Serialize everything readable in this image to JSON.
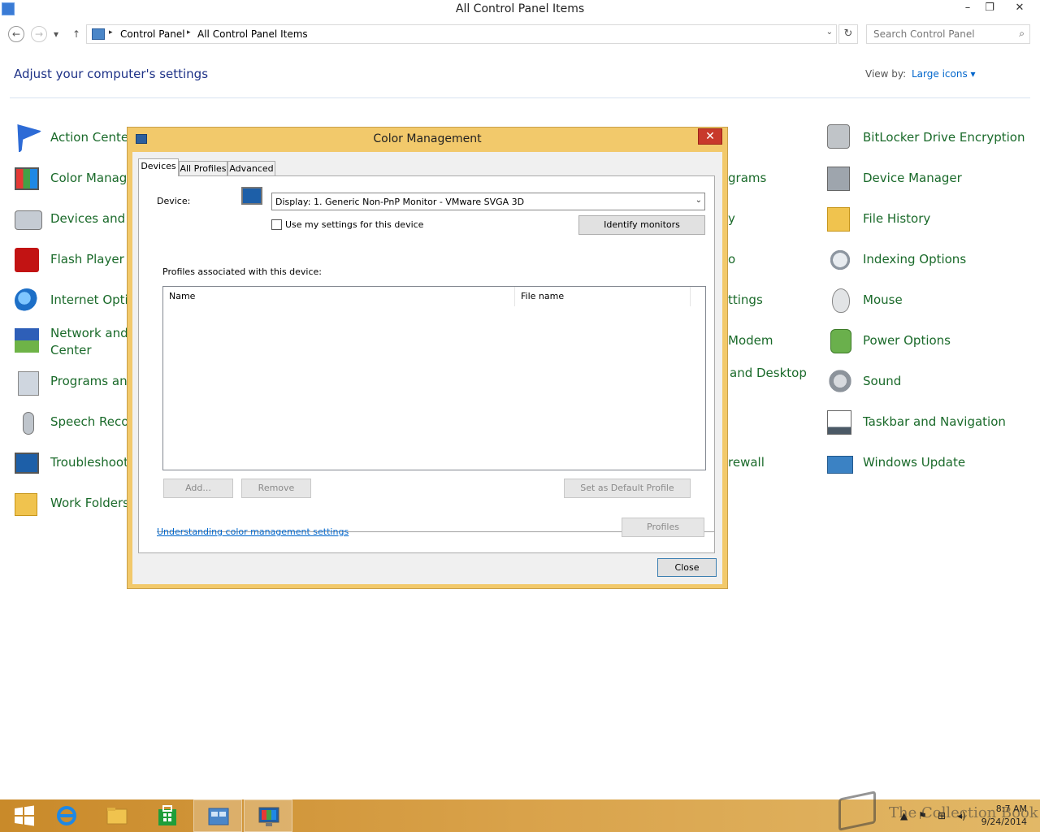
{
  "window": {
    "title": "All Control Panel Items",
    "minimize": "–",
    "restore": "❐",
    "close": "✕"
  },
  "nav": {
    "back": "←",
    "forward": "→",
    "recent": "▾",
    "up": "↑"
  },
  "address": {
    "crumbs": [
      "Control Panel",
      "All Control Panel Items"
    ],
    "separator": "▸",
    "dropdown": "⌄",
    "refresh": "↻"
  },
  "search": {
    "placeholder": "Search Control Panel",
    "icon": "⌕"
  },
  "heading": "Adjust your computer's settings",
  "view_by": {
    "label": "View by:",
    "value": "Large icons ▾"
  },
  "items_left": [
    {
      "label": "Action Center",
      "icon": "flag-icon"
    },
    {
      "label": "Color Manage",
      "icon": "color-management-icon"
    },
    {
      "label": "Devices and P",
      "icon": "devices-icon"
    },
    {
      "label": "Flash Player (",
      "icon": "flash-icon"
    },
    {
      "label": "Internet Optic",
      "icon": "internet-options-icon"
    },
    {
      "label": "Network and Center",
      "icon": "network-icon"
    },
    {
      "label": "Programs and",
      "icon": "programs-icon"
    },
    {
      "label": "Speech Recog",
      "icon": "microphone-icon"
    },
    {
      "label": "Troubleshooti",
      "icon": "troubleshooting-icon"
    },
    {
      "label": "Work Folders",
      "icon": "folder-icon"
    }
  ],
  "items_middle_partial": [
    {
      "label": "grams"
    },
    {
      "label": "y"
    },
    {
      "label": "o"
    },
    {
      "label": "ttings"
    },
    {
      "label": "Modem"
    },
    {
      "label": "and Desktop"
    },
    {
      "label": "rewall"
    }
  ],
  "items_right": [
    {
      "label": "BitLocker Drive Encryption",
      "icon": "bitlocker-icon"
    },
    {
      "label": "Device Manager",
      "icon": "device-manager-icon"
    },
    {
      "label": "File History",
      "icon": "file-history-icon"
    },
    {
      "label": "Indexing Options",
      "icon": "indexing-icon"
    },
    {
      "label": "Mouse",
      "icon": "mouse-icon"
    },
    {
      "label": "Power Options",
      "icon": "power-icon"
    },
    {
      "label": "Sound",
      "icon": "sound-icon"
    },
    {
      "label": "Taskbar and Navigation",
      "icon": "taskbar-icon"
    },
    {
      "label": "Windows Update",
      "icon": "windows-update-icon"
    }
  ],
  "dialog": {
    "title": "Color Management",
    "close": "✕",
    "tabs": [
      "Devices",
      "All Profiles",
      "Advanced"
    ],
    "device_label": "Device:",
    "device_value": "Display: 1. Generic Non-PnP Monitor - VMware SVGA 3D",
    "select_arrow": "⌄",
    "use_my_settings": "Use my settings for this device",
    "identify_monitors": "Identify monitors",
    "profiles_label": "Profiles associated with this device:",
    "columns": [
      "Name",
      "File name"
    ],
    "add": "Add...",
    "remove": "Remove",
    "set_default": "Set as Default Profile",
    "profiles": "Profiles",
    "link": "Understanding color management settings",
    "close_button": "Close"
  },
  "taskbar": {
    "time": "8:7 AM",
    "date": "9/24/2014",
    "tray_icons": [
      "▲",
      "⚑",
      "⊞",
      "◂)"
    ]
  },
  "watermark": "The Collection Book",
  "colors": {
    "accent": "#f2c96b",
    "taskbar": "#d9a24a",
    "link": "#0066cc",
    "item_text": "#1a6a2a"
  }
}
